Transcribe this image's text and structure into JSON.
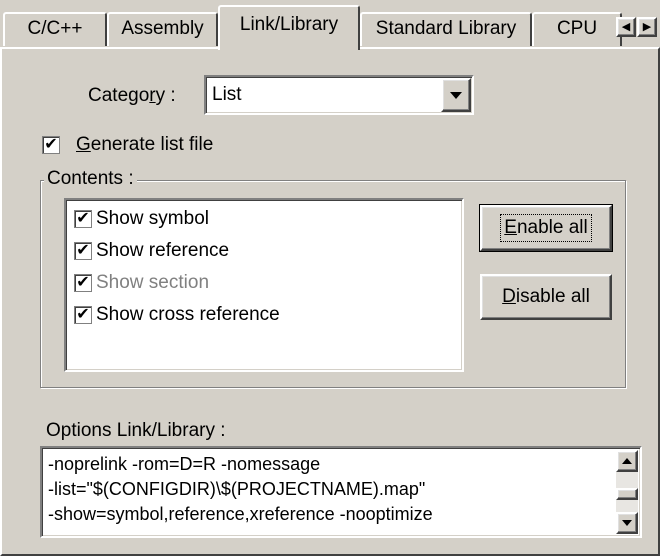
{
  "tabs": [
    {
      "label": "C/C++",
      "active": false
    },
    {
      "label": "Assembly",
      "active": false
    },
    {
      "label": "Link/Library",
      "active": true
    },
    {
      "label": "Standard Library",
      "active": false
    },
    {
      "label": "CPU",
      "active": false
    }
  ],
  "tab_scroll": {
    "left_icon": "arrow-left-icon",
    "right_icon": "arrow-right-icon"
  },
  "category": {
    "label_pre": "Catego",
    "label_key": "r",
    "label_post": "y :",
    "value": "List"
  },
  "generate_list": {
    "checked": true,
    "label_key": "G",
    "label_rest": "enerate list file"
  },
  "contents": {
    "legend": "Contents :",
    "items": [
      {
        "label": "Show symbol",
        "checked": true,
        "enabled": true
      },
      {
        "label": "Show reference",
        "checked": true,
        "enabled": true
      },
      {
        "label": "Show section",
        "checked": true,
        "enabled": false
      },
      {
        "label": "Show cross reference",
        "checked": true,
        "enabled": true
      }
    ],
    "enable_all": {
      "key": "E",
      "rest": "nable all"
    },
    "disable_all": {
      "key": "D",
      "rest": "isable all"
    }
  },
  "options": {
    "label": "Options Link/Library :",
    "lines": [
      "-noprelink -rom=D=R -nomessage",
      "-list=\"$(CONFIGDIR)\\$(PROJECTNAME).map\"",
      "-show=symbol,reference,xreference -nooptimize"
    ]
  },
  "check_glyph": "✔"
}
